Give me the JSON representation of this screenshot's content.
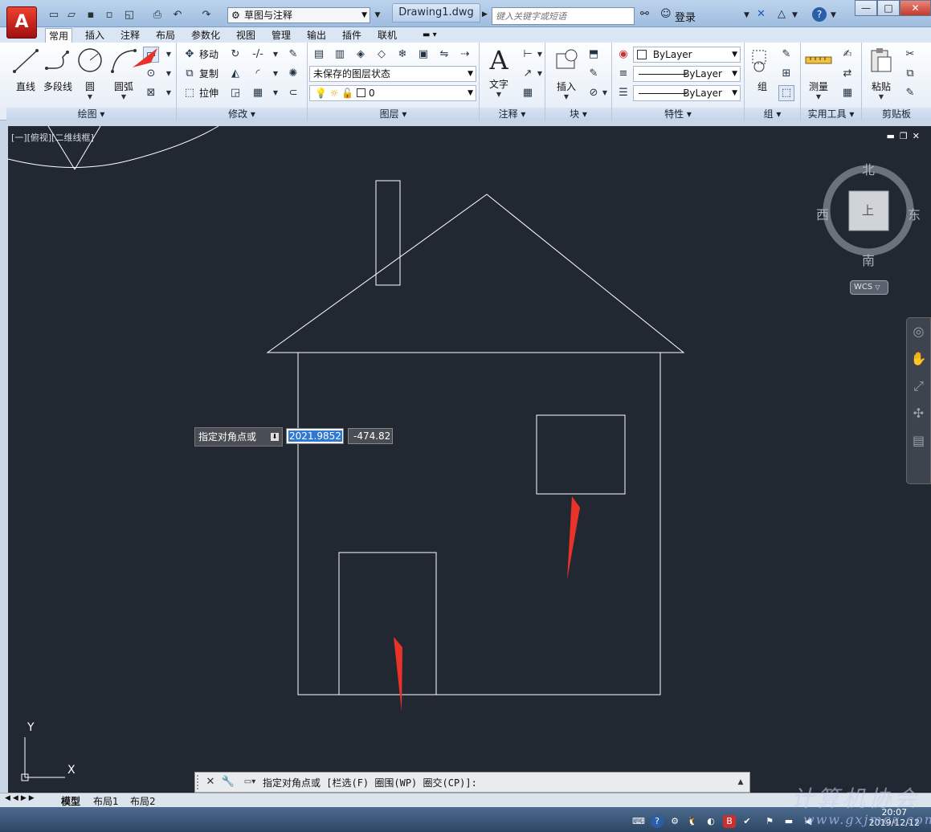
{
  "app": {
    "logo_letter": "A",
    "workspace": "草图与注释",
    "document_title": "Drawing1.dwg",
    "search_placeholder": "键入关键字或短语",
    "login_label": "登录"
  },
  "tabs": [
    "常用",
    "插入",
    "注释",
    "布局",
    "参数化",
    "视图",
    "管理",
    "输出",
    "插件",
    "联机"
  ],
  "ribbon": {
    "draw_panel": {
      "title": "绘图",
      "line": "直线",
      "polyline": "多段线",
      "circle": "圆",
      "arc": "圆弧"
    },
    "modify_panel": {
      "title": "修改",
      "move": "移动",
      "copy": "复制",
      "stretch": "拉伸"
    },
    "layer_panel": {
      "title": "图层",
      "layer_state": "未保存的图层状态",
      "current_layer": "0"
    },
    "annotation_panel": {
      "title": "注释",
      "text": "文字"
    },
    "block_panel": {
      "title": "块",
      "insert": "插入"
    },
    "properties_panel": {
      "title": "特性",
      "color": "ByLayer",
      "linetype": "ByLayer",
      "lineweight": "ByLayer"
    },
    "group_panel": {
      "title": "组",
      "group": "组"
    },
    "utilities_panel": {
      "title": "实用工具",
      "measure": "测量"
    },
    "clipboard_panel": {
      "title": "剪贴板",
      "paste": "粘贴"
    }
  },
  "viewport": {
    "label": "[一][俯视][二维线框]"
  },
  "dynamic_input": {
    "prompt": "指定对角点或",
    "x_value": "2021.9852",
    "y_value": "-474.82"
  },
  "viewcube": {
    "north": "北",
    "south": "南",
    "east": "东",
    "west": "西",
    "top_face": "上",
    "wcs": "WCS"
  },
  "ucs": {
    "x_label": "X",
    "y_label": "Y"
  },
  "command_line": {
    "prompt": "指定对角点或",
    "options": "[栏选(F) 圈围(WP) 圈交(CP)]:"
  },
  "layout_tabs": [
    "模型",
    "布局1",
    "布局2"
  ],
  "taskbar": {
    "time": "20:07",
    "date": "2019/12/12"
  },
  "watermark": {
    "text": "计算机协会",
    "url": "www.gxjmcz.com"
  }
}
